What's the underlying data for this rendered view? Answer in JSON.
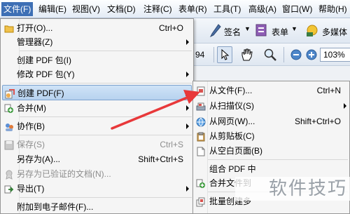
{
  "menubar": {
    "items": [
      {
        "label": "文件(F)"
      },
      {
        "label": "编辑(E)"
      },
      {
        "label": "视图(V)"
      },
      {
        "label": "文档(D)"
      },
      {
        "label": "注释(C)"
      },
      {
        "label": "表单(R)"
      },
      {
        "label": "工具(T)"
      },
      {
        "label": "高级(A)"
      },
      {
        "label": "窗口(W)"
      },
      {
        "label": "帮助(H)"
      }
    ]
  },
  "toolbar": {
    "sign_label": "签名",
    "form_label": "表单",
    "multimedia_label": "多媒体",
    "page_number_fragment": "94",
    "zoom_value": "103%"
  },
  "file_menu": {
    "items": [
      {
        "label": "打开(O)...",
        "shortcut": "Ctrl+O"
      },
      {
        "label": "管理器(Z)"
      },
      {
        "label": "创建 PDF 包(I)"
      },
      {
        "label": "修改 PDF 包(Y)"
      },
      {
        "label": "创建 PDF(F)"
      },
      {
        "label": "合并(M)"
      },
      {
        "label": "协作(B)"
      },
      {
        "label": "保存(S)",
        "shortcut": "Ctrl+S"
      },
      {
        "label": "另存为(A)...",
        "shortcut": "Shift+Ctrl+S"
      },
      {
        "label": "另存为已验证的文档(N)..."
      },
      {
        "label": "导出(T)"
      },
      {
        "label": "附加到电子邮件(F)..."
      }
    ]
  },
  "create_pdf_submenu": {
    "items": [
      {
        "label": "从文件(F)...",
        "shortcut": "Ctrl+N"
      },
      {
        "label": "从扫描仪(S)"
      },
      {
        "label": "从网页(W)...",
        "shortcut": "Shift+Ctrl+O"
      },
      {
        "label": "从剪贴板(C)"
      },
      {
        "label": "从空白页面(B)"
      },
      {
        "label": "组合 PDF 中"
      },
      {
        "label": "合并文件到"
      },
      {
        "label": "批量创建多"
      }
    ]
  },
  "watermark": {
    "text": "软件技巧"
  },
  "colors": {
    "menubar_active": "#3d6fb5",
    "highlight": "#b7d2ef",
    "annotation_arrow": "#e8383a"
  }
}
